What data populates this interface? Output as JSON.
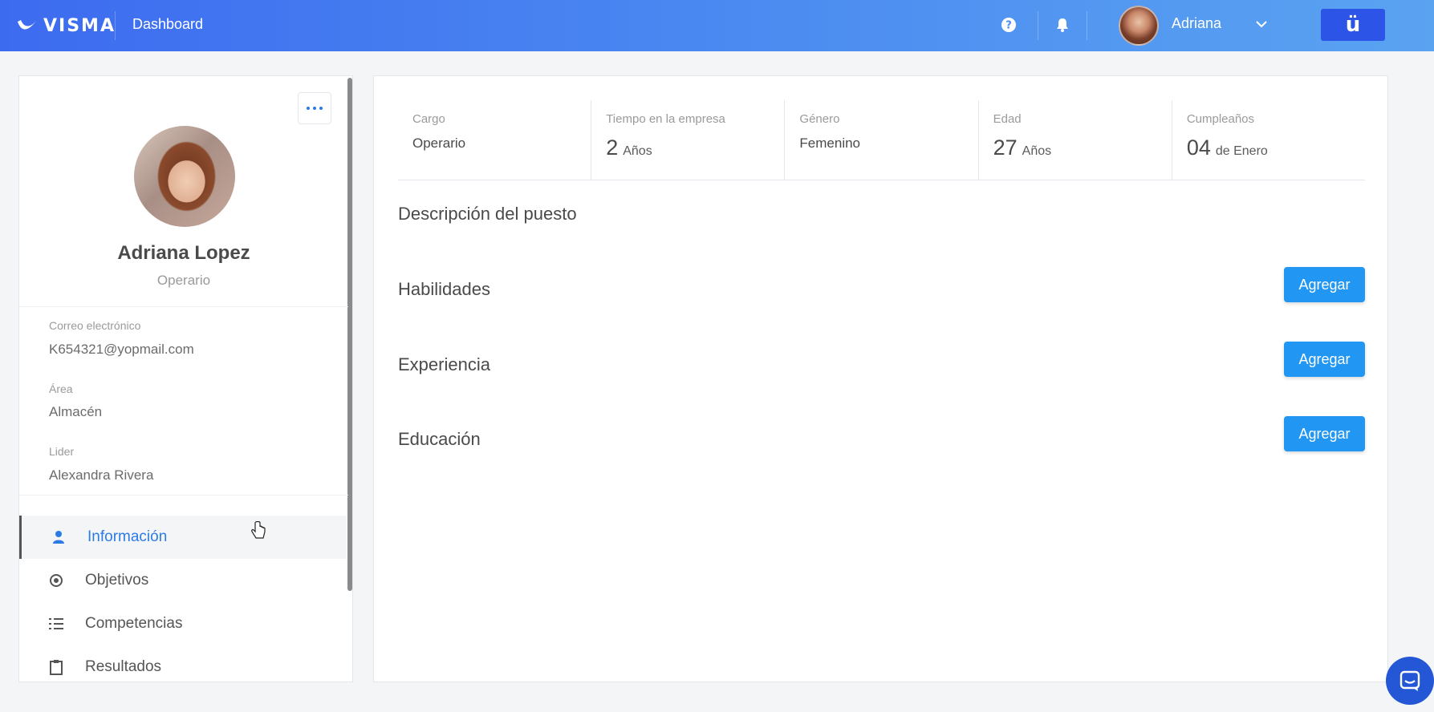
{
  "header": {
    "logo_text": "VISMA",
    "dashboard_label": "Dashboard",
    "user_name": "Adriana",
    "brand_glyph": "ü"
  },
  "profile": {
    "name": "Adriana Lopez",
    "role": "Operario",
    "fields": [
      {
        "label": "Correo electrónico",
        "value": "K654321@yopmail.com"
      },
      {
        "label": "Área",
        "value": "Almacén"
      },
      {
        "label": "Lider",
        "value": "Alexandra Rivera"
      }
    ]
  },
  "menu": [
    {
      "label": "Información",
      "icon": "user-icon",
      "active": true
    },
    {
      "label": "Objetivos",
      "icon": "target-icon"
    },
    {
      "label": "Competencias",
      "icon": "list-icon"
    },
    {
      "label": "Resultados",
      "icon": "clipboard-icon"
    }
  ],
  "stats": [
    {
      "label": "Cargo",
      "value": "Operario"
    },
    {
      "label": "Tiempo en la empresa",
      "number": "2",
      "unit": "Años"
    },
    {
      "label": "Género",
      "value": "Femenino"
    },
    {
      "label": "Edad",
      "number": "27",
      "unit": "Años"
    },
    {
      "label": "Cumpleaños",
      "number": "04",
      "unit": "de Enero"
    }
  ],
  "sections": {
    "descripcion": "Descripción del puesto",
    "habilidades": "Habilidades",
    "experiencia": "Experiencia",
    "educacion": "Educación",
    "add_label": "Agregar"
  },
  "colors": {
    "accent": "#2c7be5",
    "button": "#2196f3",
    "header_start": "#3d6bf0",
    "header_end": "#5aa3f1"
  }
}
